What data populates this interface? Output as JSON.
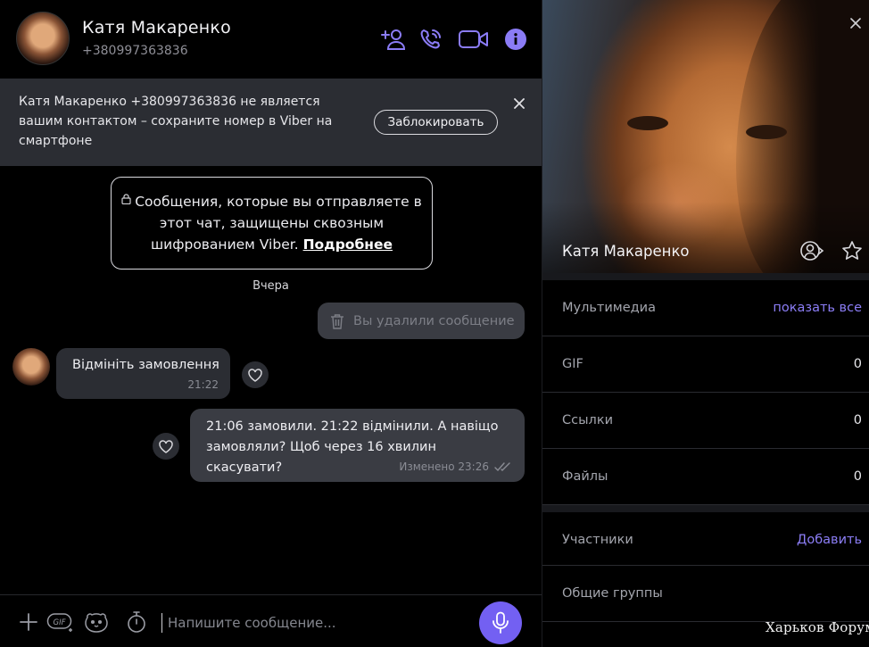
{
  "header": {
    "contact_name": "Катя Макаренко",
    "contact_phone": "+380997363836",
    "icons": [
      "add-contact-icon",
      "call-icon",
      "video-call-icon",
      "info-icon"
    ]
  },
  "banner": {
    "text": "Катя Макаренко +380997363836 не является вашим контактом – сохраните номер в Viber на смартфоне",
    "block_label": "Заблокировать"
  },
  "e2e_notice": {
    "text": "Сообщения, которые вы отправляете в этот чат, защищены сквозным шифрованием Viber.",
    "link": "Подробнее"
  },
  "chat": {
    "day_separator": "Вчера",
    "deleted_message": "Вы удалили сообщение",
    "incoming": {
      "text": "Відмініть замовлення",
      "time": "21:22"
    },
    "outgoing": {
      "text": "21:06 замовили. 21:22 відмінили.  А навіщо замовляли? Щоб через 16 хвилин скасувати?",
      "meta": "Изменено 23:26"
    }
  },
  "composer": {
    "placeholder": "Напишите сообщение...",
    "icons": [
      "plus-icon",
      "gif-icon",
      "sticker-icon",
      "timer-icon",
      "microphone-icon"
    ]
  },
  "info_panel": {
    "name": "Катя Макаренко",
    "rows": [
      {
        "label": "Мультимедиа",
        "action": "показать все"
      },
      {
        "label": "GIF",
        "value": "0"
      },
      {
        "label": "Ссылки",
        "value": "0"
      },
      {
        "label": "Файлы",
        "value": "0"
      },
      {
        "label": "Участники",
        "action": "Добавить"
      },
      {
        "label": "Общие группы"
      }
    ]
  },
  "watermark": "Харьков Форум",
  "colors": {
    "accent": "#7360f2",
    "link_accent": "#8c7ef7",
    "bubble_in": "#2b2d33",
    "bubble_out": "#3a3c43",
    "banner_bg": "#2b2d33"
  }
}
